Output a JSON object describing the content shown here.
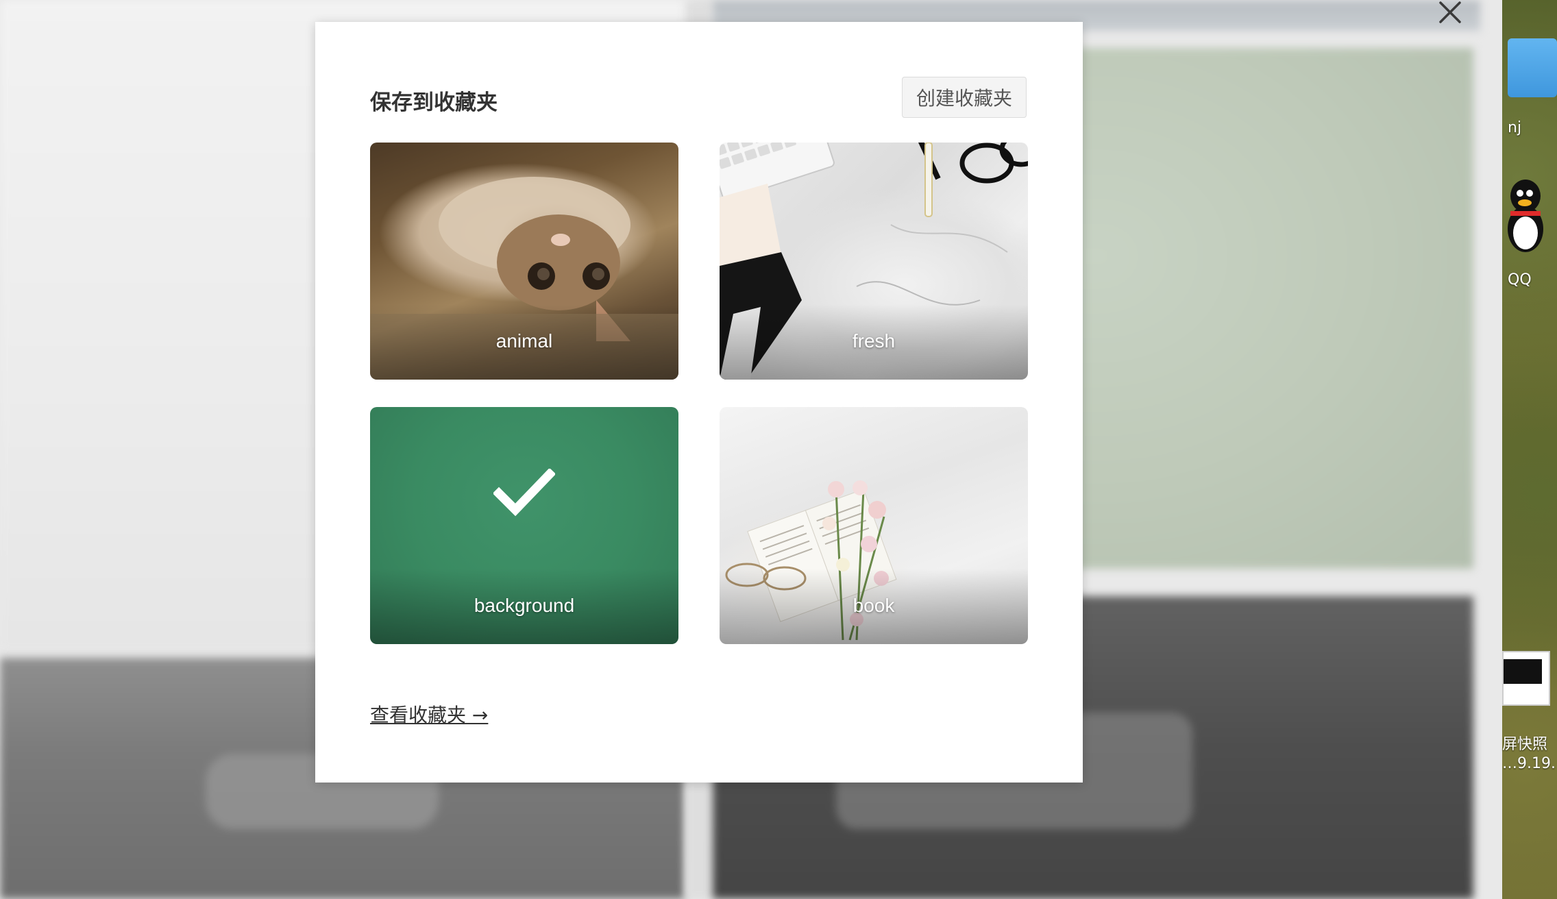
{
  "dialog": {
    "title": "保存到收藏夹",
    "create_button": "创建收藏夹",
    "collections": [
      {
        "label": "animal",
        "selected": false
      },
      {
        "label": "fresh",
        "selected": false
      },
      {
        "label": "background",
        "selected": true
      },
      {
        "label": "book",
        "selected": false
      }
    ],
    "view_link": "查看收藏夹 →"
  },
  "desktop": {
    "icon_labels": [
      "nj",
      "QQ"
    ],
    "screenshot_label_line1": "屏快照",
    "screenshot_label_line2": "…9.19."
  },
  "icons": {
    "close": "close-icon",
    "selected": "checkmark-icon"
  },
  "colors": {
    "modal_bg": "#ffffff",
    "selected_tile": "#3a8b62",
    "title_text": "#333333"
  }
}
